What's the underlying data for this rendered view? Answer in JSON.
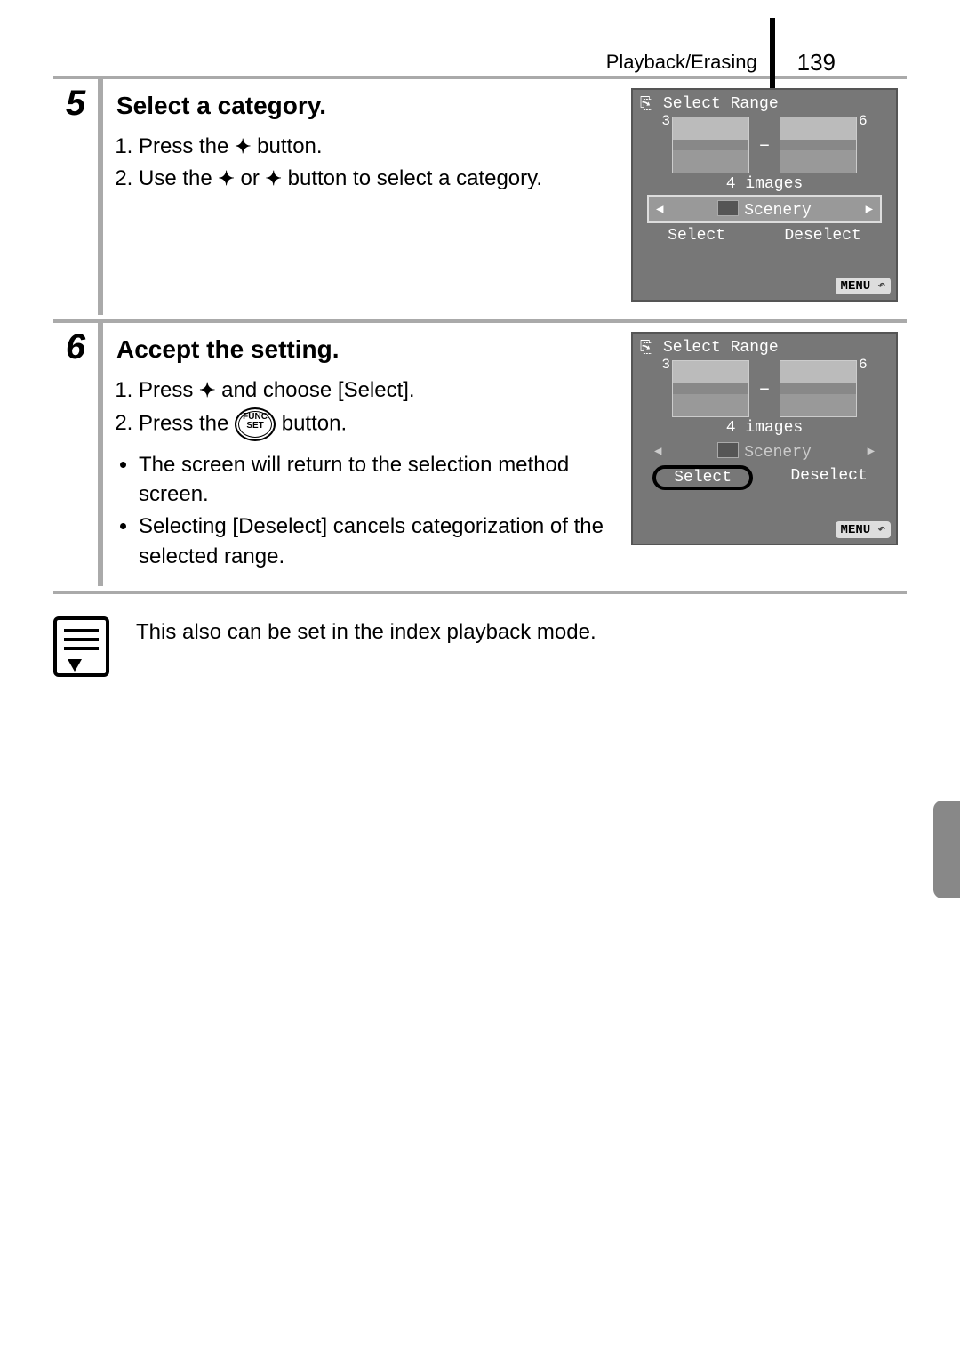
{
  "header": {
    "section": "Playback/Erasing",
    "page": "139"
  },
  "step5": {
    "num": "5",
    "title": "Select a category.",
    "list": {
      "i1_a": "Press the ",
      "i1_b": " button.",
      "i2_a": "Use the ",
      "i2_or": " or ",
      "i2_b": " button to select a category."
    },
    "screen": {
      "title": "Select Range",
      "leftNum": "3",
      "rightNum": "6",
      "count": "4 images",
      "category": "Scenery",
      "select": "Select",
      "deselect": "Deselect",
      "menu": "MENU"
    }
  },
  "step6": {
    "num": "6",
    "title": "Accept the setting.",
    "list": {
      "i1_a": "Press ",
      "i1_b": " and choose [Select].",
      "i2_a": "Press the ",
      "i2_b": " button."
    },
    "bullets": {
      "b1": "The screen will return to the selection method screen.",
      "b2": "Selecting [Deselect] cancels categorization of the selected range."
    },
    "screen": {
      "title": "Select Range",
      "leftNum": "3",
      "rightNum": "6",
      "count": "4 images",
      "category": "Scenery",
      "select": "Select",
      "deselect": "Deselect",
      "menu": "MENU"
    }
  },
  "funcset": {
    "top": "FUNC",
    "bot": "SET"
  },
  "note": {
    "text": "This also can be set in the index playback mode."
  }
}
